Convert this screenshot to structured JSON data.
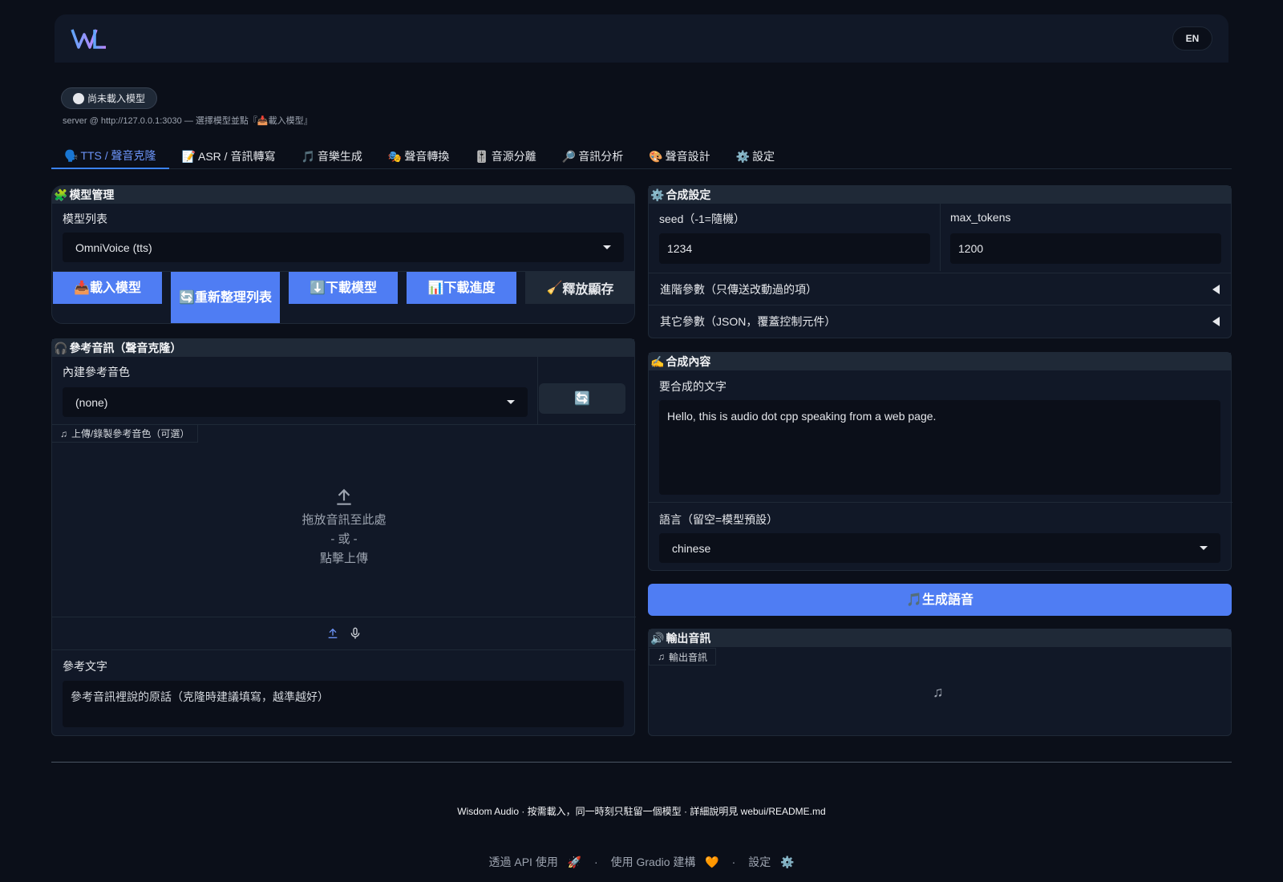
{
  "header": {
    "lang_button": "EN"
  },
  "status": {
    "pill": "尚未載入模型",
    "server_line": "server @ http://127.0.0.1:3030 — 選擇模型並點『📥載入模型』"
  },
  "tabs": [
    {
      "icon": "🗣️",
      "label": "TTS / 聲音克隆"
    },
    {
      "icon": "📝",
      "label": "ASR / 音訊轉寫"
    },
    {
      "icon": "🎵",
      "label": "音樂生成"
    },
    {
      "icon": "🎭",
      "label": "聲音轉換"
    },
    {
      "icon": "🎚️",
      "label": "音源分離"
    },
    {
      "icon": "🔎",
      "label": "音訊分析"
    },
    {
      "icon": "🎨",
      "label": "聲音設計"
    },
    {
      "icon": "⚙️",
      "label": "設定"
    }
  ],
  "model_panel": {
    "icon": "🧩",
    "title": "模型管理",
    "list_label": "模型列表",
    "selected_model": "OmniVoice (tts)",
    "buttons": {
      "load": "載入模型",
      "load_icon": "📥",
      "refresh": "重新整理列表",
      "refresh_icon": "🔄",
      "download": "下載模型",
      "download_icon": "⬇️",
      "progress": "下載進度",
      "progress_icon": "📊",
      "release": "釋放顯存",
      "release_icon": "🧹"
    }
  },
  "reference_panel": {
    "icon": "🎧",
    "title": "參考音訊（聲音克隆）",
    "voice_label": "內建參考音色",
    "voice_selected": "(none)",
    "refresh_icon": "🔄",
    "upload_tag": "上傳/錄製參考音色（可選）",
    "drop_line1": "拖放音訊至此處",
    "drop_line2": "- 或 -",
    "drop_line3": "點擊上傳",
    "ref_text_label": "參考文字",
    "ref_text_placeholder": "參考音訊裡說的原話（克隆時建議填寫，越準越好）"
  },
  "synth_settings": {
    "icon": "⚙️",
    "title": "合成設定",
    "seed_label": "seed（-1=隨機）",
    "seed_value": "1234",
    "max_tokens_label": "max_tokens",
    "max_tokens_value": "1200",
    "advanced_label": "進階參數（只傳送改動過的項）",
    "other_label": "其它參數（JSON，覆蓋控制元件）"
  },
  "synth_content": {
    "icon": "✍️",
    "title": "合成內容",
    "text_label": "要合成的文字",
    "text_value": "Hello, this is audio dot cpp speaking from a web page.",
    "lang_label": "語言（留空=模型預設）",
    "lang_value": "chinese"
  },
  "generate": {
    "icon": "🎵",
    "label": "生成語音"
  },
  "output": {
    "icon": "🔊",
    "title": "輸出音訊",
    "tag": "輸出音訊"
  },
  "footer": {
    "line1": "Wisdom Audio · 按需載入，同一時刻只駐留一個模型 · 詳細說明見 webui/README.md",
    "api": "透過 API 使用",
    "api_icon": "🚀",
    "gradio": "使用 Gradio 建構",
    "gradio_icon": "🧡",
    "settings": "設定",
    "settings_icon": "⚙️",
    "sep": "·"
  },
  "colors": {
    "accent": "#4f7df3",
    "bg": "#0b0f19",
    "panel": "#111827"
  }
}
